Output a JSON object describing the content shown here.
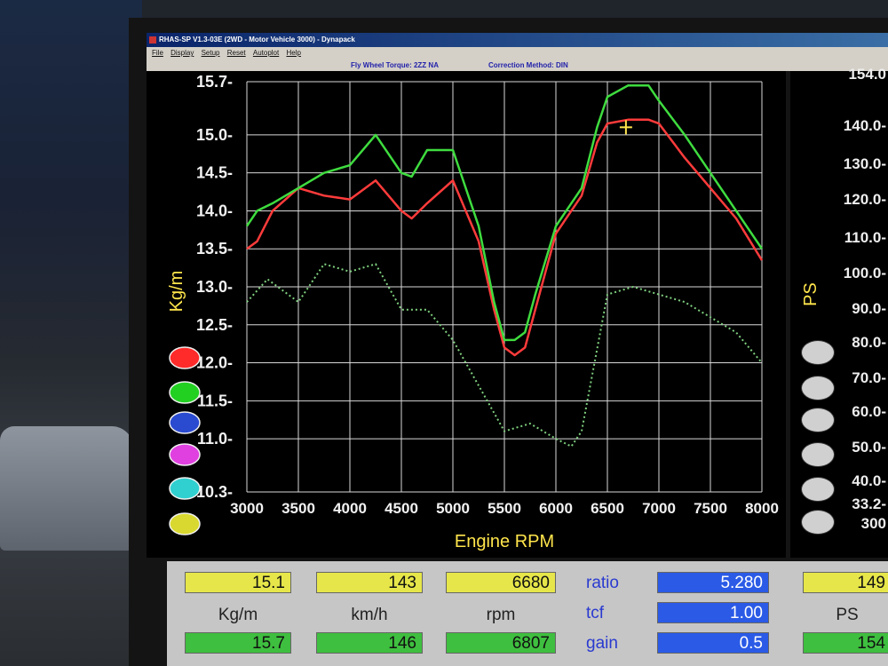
{
  "window": {
    "title": "RHAS-SP V1.3-03E  (2WD - Motor Vehicle 3000) - Dynapack",
    "menu": [
      "File",
      "Display",
      "Setup",
      "Reset",
      "Autoplot",
      "Help"
    ],
    "info_torque": "Fly Wheel Torque: 2ZZ NA",
    "info_correction": "Correction Method: DIN"
  },
  "chart_data": {
    "type": "line",
    "xlabel": "Engine RPM",
    "ylabel": "Kg/m",
    "xlim": [
      3000,
      8000
    ],
    "ylim": [
      10.3,
      15.7
    ],
    "x_ticks": [
      "3000",
      "3500",
      "4000",
      "4500",
      "5000",
      "5500",
      "6000",
      "6500",
      "7000",
      "7500",
      "8000"
    ],
    "y_ticks": [
      "15.7",
      "15.0",
      "14.5",
      "14.0",
      "13.5",
      "13.0",
      "12.5",
      "12.0",
      "11.5",
      "11.0",
      "10.3"
    ],
    "grid": true,
    "series": [
      {
        "color": "#ff3b3b",
        "style": "solid",
        "x": [
          3000,
          3100,
          3250,
          3500,
          3750,
          4000,
          4250,
          4500,
          4600,
          4750,
          5000,
          5250,
          5400,
          5500,
          5600,
          5700,
          5800,
          6000,
          6250,
          6400,
          6500,
          6700,
          6900,
          7000,
          7250,
          7500,
          7750,
          8000
        ],
        "y": [
          13.5,
          13.6,
          14.0,
          14.3,
          14.2,
          14.15,
          14.4,
          14.0,
          13.9,
          14.1,
          14.4,
          13.6,
          12.7,
          12.2,
          12.1,
          12.2,
          12.7,
          13.7,
          14.2,
          14.9,
          15.15,
          15.2,
          15.2,
          15.15,
          14.7,
          14.3,
          13.9,
          13.35
        ]
      },
      {
        "color": "#3fdc3f",
        "style": "solid",
        "x": [
          3000,
          3100,
          3250,
          3500,
          3750,
          4000,
          4250,
          4500,
          4600,
          4750,
          5000,
          5250,
          5400,
          5500,
          5600,
          5700,
          5800,
          6000,
          6250,
          6400,
          6500,
          6700,
          6900,
          7000,
          7250,
          7500,
          7750,
          8000
        ],
        "y": [
          13.8,
          14.0,
          14.1,
          14.3,
          14.5,
          14.6,
          15.0,
          14.5,
          14.45,
          14.8,
          14.8,
          13.8,
          12.8,
          12.3,
          12.3,
          12.4,
          12.9,
          13.8,
          14.3,
          15.1,
          15.5,
          15.65,
          15.65,
          15.45,
          15.0,
          14.5,
          14.0,
          13.5
        ]
      },
      {
        "color": "#7fd07f",
        "style": "dotted",
        "x": [
          3000,
          3200,
          3500,
          3750,
          4000,
          4250,
          4500,
          4750,
          5000,
          5250,
          5500,
          5750,
          6000,
          6150,
          6250,
          6500,
          6750,
          7000,
          7250,
          7500,
          7750,
          8000
        ],
        "y": [
          12.8,
          13.1,
          12.8,
          13.3,
          13.2,
          13.3,
          12.7,
          12.7,
          12.3,
          11.7,
          11.1,
          11.2,
          11.0,
          10.9,
          11.1,
          12.9,
          13.0,
          12.9,
          12.8,
          12.6,
          12.4,
          12.0
        ]
      }
    ],
    "marker": {
      "x": 6680,
      "y": 15.1
    }
  },
  "power_axis": {
    "label": "PS",
    "ticks": [
      "154.0",
      "140.0",
      "130.0",
      "120.0",
      "110.0",
      "100.0",
      "90.0",
      "80.0",
      "70.0",
      "60.0",
      "50.0",
      "40.0",
      "33.2",
      "300"
    ]
  },
  "channel_colors": [
    "#ff2a2a",
    "#22d022",
    "#2a4ad0",
    "#e040e0",
    "#30d0d0",
    "#d8d830"
  ],
  "readouts": {
    "row1": {
      "torque": "15.1",
      "speed": "143",
      "rpm": "6680",
      "ratio": "5.280",
      "ps": "149"
    },
    "labels": {
      "torque": "Kg/m",
      "speed": "km/h",
      "rpm": "rpm",
      "ratio": "ratio",
      "tcf": "tcf",
      "gain": "gain",
      "ps": "PS"
    },
    "tcf": "1.00",
    "row3": {
      "torque": "15.7",
      "speed": "146",
      "rpm": "6807",
      "gain": "0.5",
      "ps": "154"
    }
  }
}
